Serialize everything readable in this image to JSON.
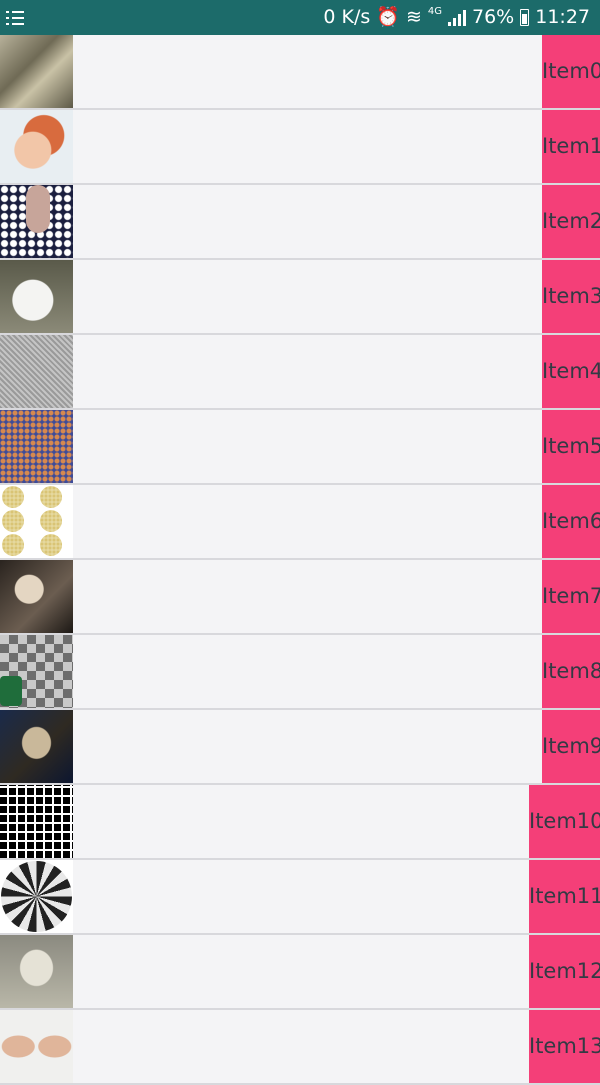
{
  "status_bar": {
    "network_speed": "0 K/s",
    "network_type": "4G",
    "battery": "76%",
    "time": "11:27",
    "icons": [
      "menu-icon",
      "alarm-icon",
      "wifi-icon",
      "signal-icon",
      "battery-icon"
    ]
  },
  "items": [
    {
      "label": "Item0"
    },
    {
      "label": "Item1"
    },
    {
      "label": "Item2"
    },
    {
      "label": "Item3"
    },
    {
      "label": "Item4"
    },
    {
      "label": "Item5"
    },
    {
      "label": "Item6"
    },
    {
      "label": "Item7"
    },
    {
      "label": "Item8"
    },
    {
      "label": "Item9"
    },
    {
      "label": "Item10"
    },
    {
      "label": "Item11"
    },
    {
      "label": "Item12"
    },
    {
      "label": "Item13"
    }
  ],
  "colors": {
    "status_bar": "#1c6b6a",
    "label_bg": "#f43f78",
    "label_text": "#333a44",
    "row_bg": "#f4f4f6"
  }
}
